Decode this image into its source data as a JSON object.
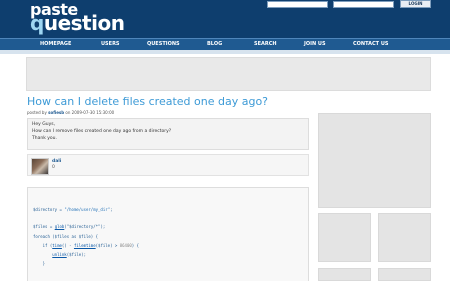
{
  "header": {
    "logo_top": "paste",
    "logo_bottom_prefix": "",
    "logo_bottom_q": "q",
    "logo_bottom_rest": "uestion",
    "login_label": "LOGIN"
  },
  "nav": {
    "items": [
      "HOMEPAGE",
      "USERS",
      "QUESTIONS",
      "BLOG",
      "SEARCH",
      "JOIN US",
      "CONTACT US"
    ]
  },
  "post": {
    "title": "How can I delete files created one day ago?",
    "meta_prefix": "posted by ",
    "author": "sofiesb",
    "meta_suffix": " on 2009-07-30 15:30:00",
    "lines": [
      "Hey Guys,",
      "How can I remove files created one day ago from a directory?",
      "Thank you."
    ]
  },
  "answer": {
    "author": "dali",
    "score": "0"
  },
  "code": {
    "line1_var": "$directory = ",
    "line1_str": "\"/home/user/my_dir\"",
    "line1_end": ";",
    "line2_var": "$files = ",
    "line2_fn": "glob",
    "line2_rest": "(\"$directory/*\");",
    "line3": "foreach ($files as $file) {",
    "line4_pre": "    if (",
    "line4_fn1": "time",
    "line4_mid": "() - ",
    "line4_fn2": "filemtime",
    "line4_rest": "($file) > ",
    "line4_cm": "86400",
    "line4_end": ") {",
    "line5_pre": "        ",
    "line5_fn": "unlink",
    "line5_rest": "($file);",
    "line6": "    }"
  }
}
